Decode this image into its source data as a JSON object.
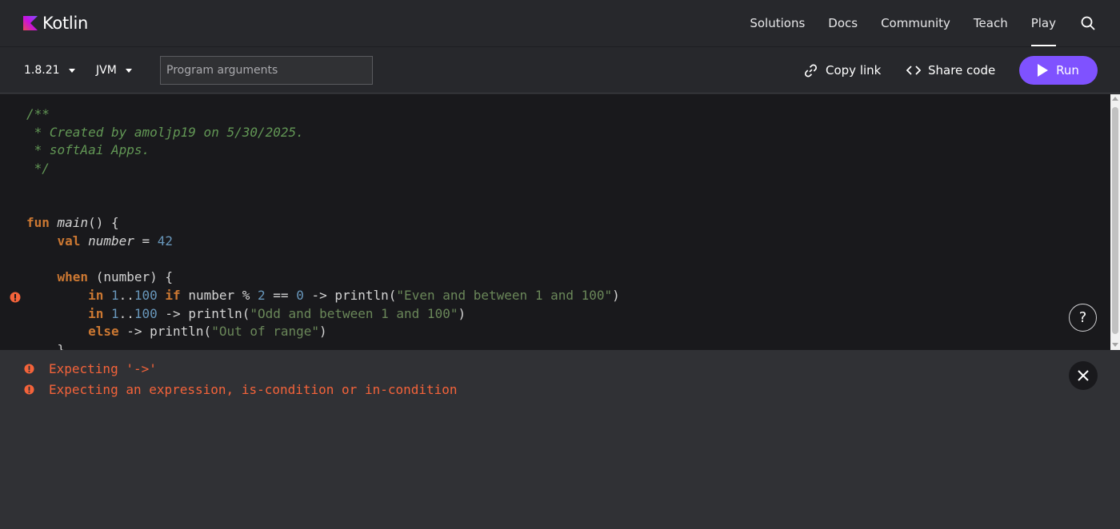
{
  "header": {
    "logo_text": "Kotlin",
    "nav": [
      "Solutions",
      "Docs",
      "Community",
      "Teach",
      "Play"
    ],
    "active_nav": "Play"
  },
  "toolbar": {
    "version": "1.8.21",
    "platform": "JVM",
    "args_placeholder": "Program arguments",
    "args_value": "",
    "copy_link": "Copy link",
    "share_code": "Share code",
    "run": "Run"
  },
  "editor": {
    "lines": [
      [
        {
          "t": "/**",
          "c": "comment"
        }
      ],
      [
        {
          "t": " * Created by amoljp19 on 5/30/2025.",
          "c": "comment"
        }
      ],
      [
        {
          "t": " * softAai Apps.",
          "c": "comment"
        }
      ],
      [
        {
          "t": " */",
          "c": "comment"
        }
      ],
      [],
      [],
      [
        {
          "t": "fun",
          "c": "kw"
        },
        {
          "t": " ",
          "c": "plain"
        },
        {
          "t": "main",
          "c": "fn"
        },
        {
          "t": "() {",
          "c": "plain"
        }
      ],
      [
        {
          "t": "    ",
          "c": "plain"
        },
        {
          "t": "val",
          "c": "kw"
        },
        {
          "t": " ",
          "c": "plain"
        },
        {
          "t": "number",
          "c": "var"
        },
        {
          "t": " = ",
          "c": "plain"
        },
        {
          "t": "42",
          "c": "num"
        }
      ],
      [],
      [
        {
          "t": "    ",
          "c": "plain"
        },
        {
          "t": "when",
          "c": "kw"
        },
        {
          "t": " (number) {",
          "c": "plain"
        }
      ],
      [
        {
          "t": "        ",
          "c": "plain"
        },
        {
          "t": "in",
          "c": "kw"
        },
        {
          "t": " ",
          "c": "plain"
        },
        {
          "t": "1",
          "c": "num"
        },
        {
          "t": "..",
          "c": "plain"
        },
        {
          "t": "100",
          "c": "num"
        },
        {
          "t": " ",
          "c": "plain"
        },
        {
          "t": "if",
          "c": "kw"
        },
        {
          "t": " number % ",
          "c": "plain"
        },
        {
          "t": "2",
          "c": "num"
        },
        {
          "t": " == ",
          "c": "plain"
        },
        {
          "t": "0",
          "c": "num"
        },
        {
          "t": " -> println(",
          "c": "plain"
        },
        {
          "t": "\"Even and between 1 and 100\"",
          "c": "str"
        },
        {
          "t": ")",
          "c": "plain"
        }
      ],
      [
        {
          "t": "        ",
          "c": "plain"
        },
        {
          "t": "in",
          "c": "kw"
        },
        {
          "t": " ",
          "c": "plain"
        },
        {
          "t": "1",
          "c": "num"
        },
        {
          "t": "..",
          "c": "plain"
        },
        {
          "t": "100",
          "c": "num"
        },
        {
          "t": " -> println(",
          "c": "plain"
        },
        {
          "t": "\"Odd and between 1 and 100\"",
          "c": "str"
        },
        {
          "t": ")",
          "c": "plain"
        }
      ],
      [
        {
          "t": "        ",
          "c": "plain"
        },
        {
          "t": "else",
          "c": "kw"
        },
        {
          "t": " -> println(",
          "c": "plain"
        },
        {
          "t": "\"Out of range\"",
          "c": "str"
        },
        {
          "t": ")",
          "c": "plain"
        }
      ],
      [
        {
          "t": "    }",
          "c": "plain"
        }
      ]
    ],
    "error_line": 11,
    "help_label": "?"
  },
  "console": {
    "errors": [
      "Expecting '->'",
      "Expecting an expression, is-condition or in-condition"
    ]
  },
  "colors": {
    "accent": "#7f52ff",
    "error": "#f4633a"
  }
}
